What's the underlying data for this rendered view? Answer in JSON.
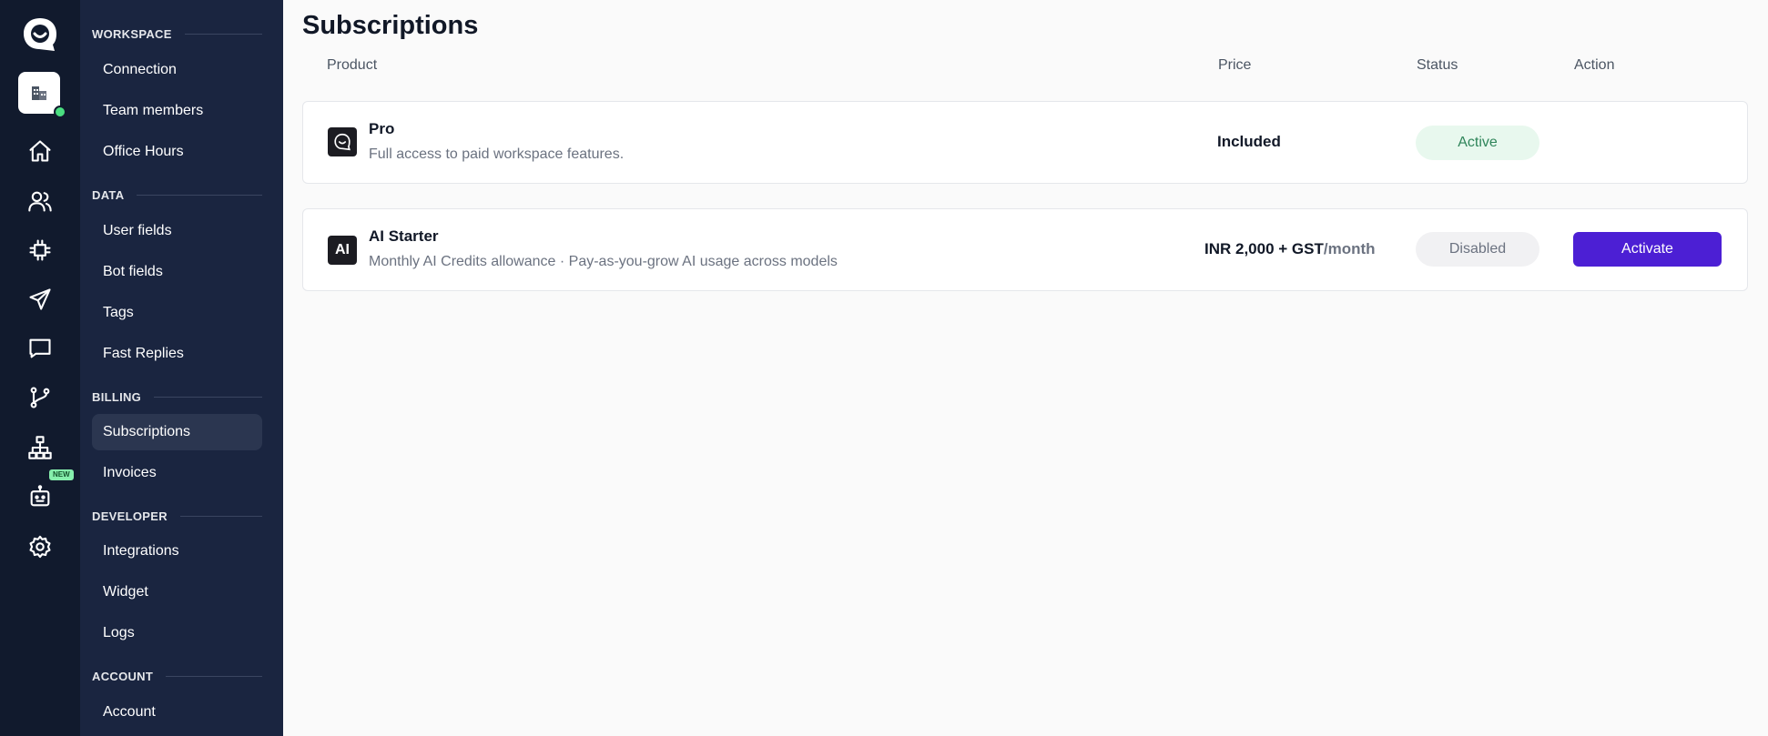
{
  "sidebar": {
    "sections": [
      {
        "title": "WORKSPACE",
        "items": [
          "Connection",
          "Team members",
          "Office Hours"
        ]
      },
      {
        "title": "DATA",
        "items": [
          "User fields",
          "Bot fields",
          "Tags",
          "Fast Replies"
        ]
      },
      {
        "title": "BILLING",
        "items": [
          "Subscriptions",
          "Invoices"
        ]
      },
      {
        "title": "DEVELOPER",
        "items": [
          "Integrations",
          "Widget",
          "Logs"
        ]
      },
      {
        "title": "ACCOUNT",
        "items": [
          "Account"
        ]
      }
    ],
    "active_item": "Subscriptions"
  },
  "rail": {
    "new_badge": "NEW",
    "icons": [
      "logo-icon",
      "workspace-icon",
      "home-icon",
      "users-icon",
      "integrations-icon",
      "broadcast-icon",
      "chat-icon",
      "flows-icon",
      "sitemap-icon",
      "bot-icon",
      "settings-icon"
    ]
  },
  "page": {
    "title": "Subscriptions",
    "columns": {
      "product": "Product",
      "price": "Price",
      "status": "Status",
      "action": "Action"
    }
  },
  "subscriptions": [
    {
      "icon": "chat-logo-icon",
      "name": "Pro",
      "description": "Full access to paid workspace features.",
      "price": "Included",
      "status": "Active"
    },
    {
      "icon_text": "AI",
      "name": "AI Starter",
      "description": "Monthly AI Credits allowance · Pay-as-you-grow AI usage across models",
      "price": "INR 2,000 + GST",
      "price_period": "/month",
      "status": "Disabled",
      "action": "Activate"
    }
  ],
  "colors": {
    "rail_bg": "#111a2d",
    "sidebar_bg": "#1a2540",
    "accent": "#4c1fd4",
    "status_active": "#2f855a",
    "online_dot": "#4ade80"
  }
}
